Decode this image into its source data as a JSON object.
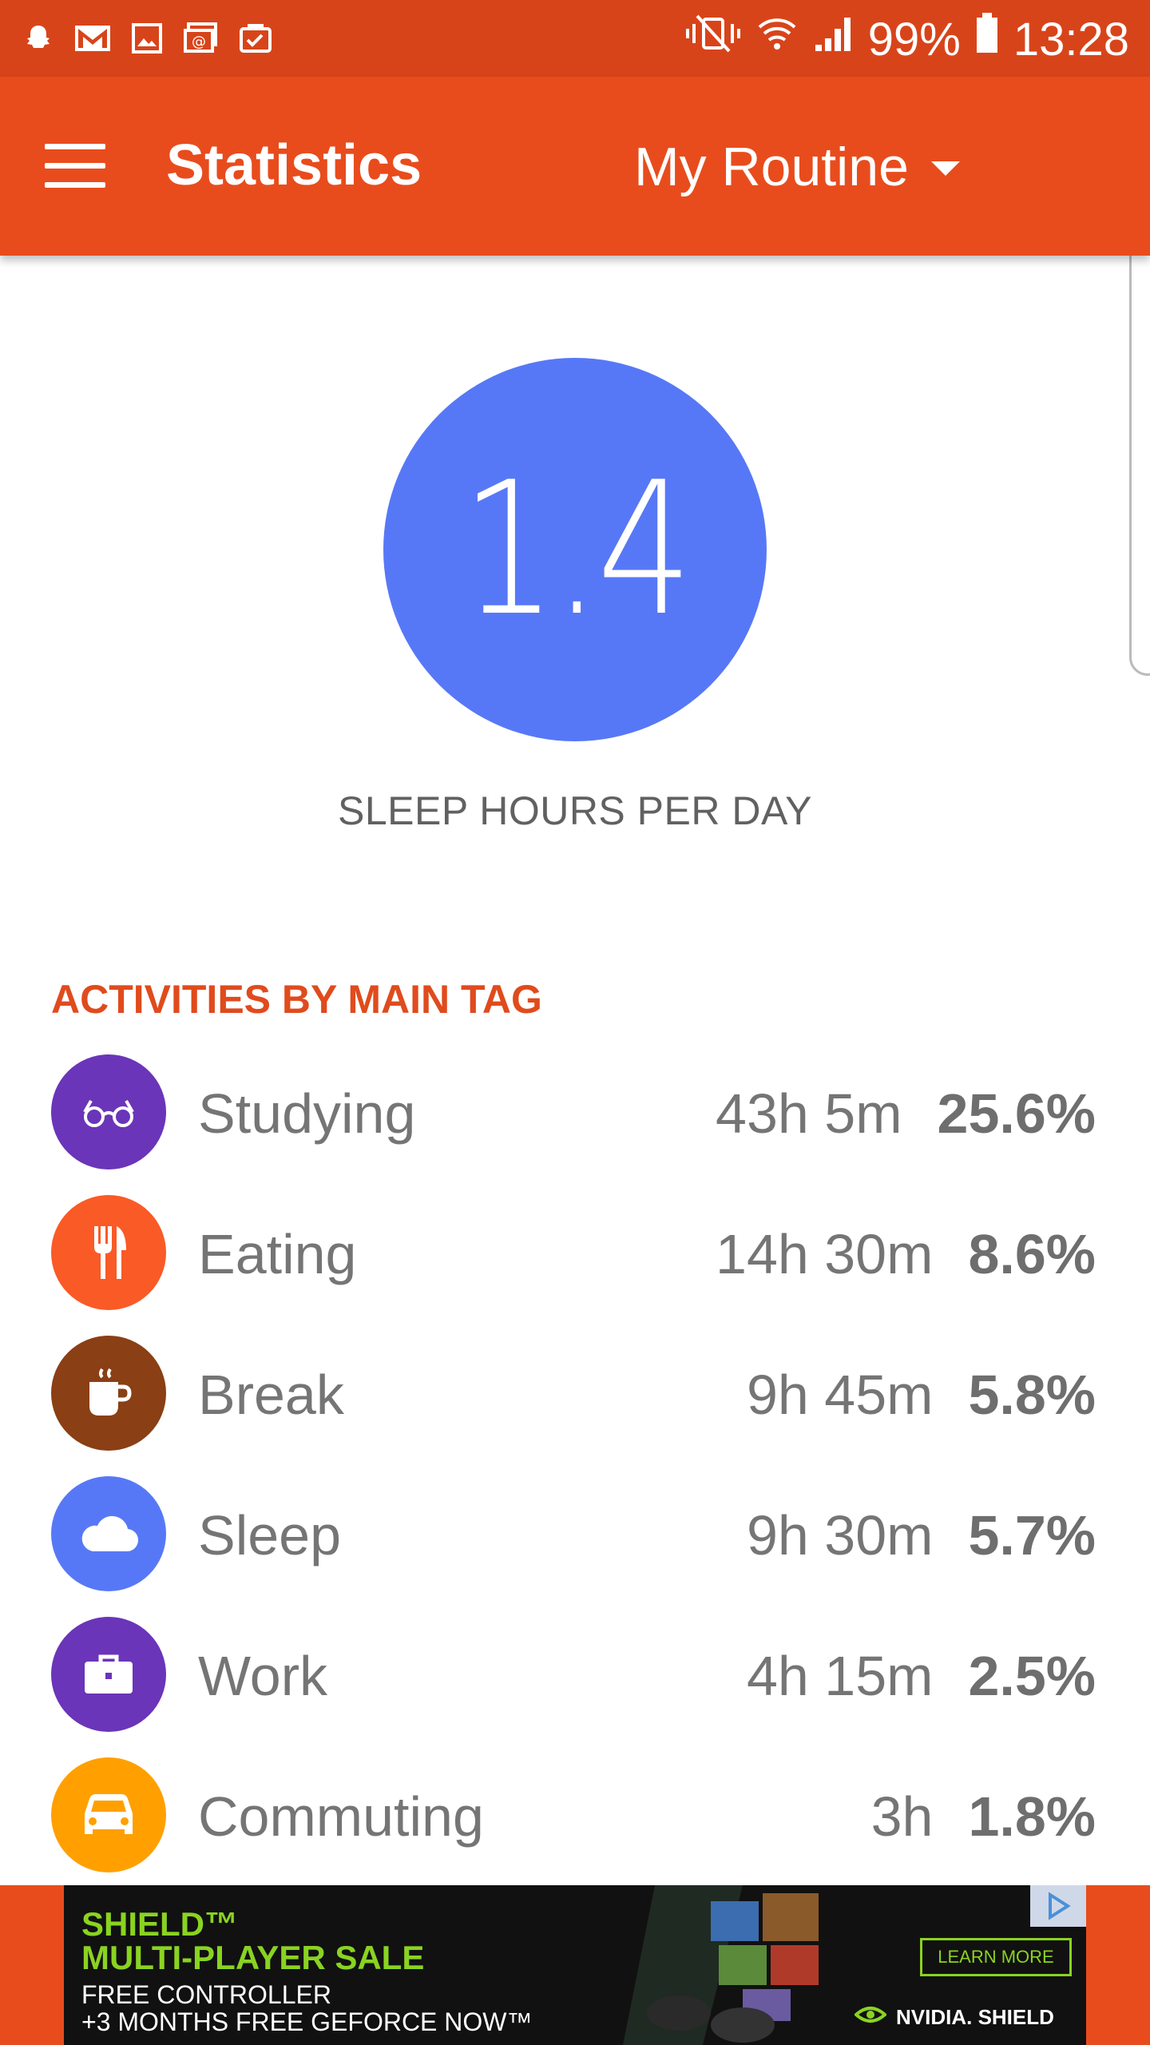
{
  "status_bar": {
    "icons_left": [
      "snapchat-icon",
      "gmail-icon",
      "gallery-icon",
      "email-icon",
      "task-icon"
    ],
    "icons_right": [
      "vibrate-mute-icon",
      "wifi-icon",
      "signal-icon",
      "battery-icon"
    ],
    "battery": "99%",
    "time": "13:28"
  },
  "app_bar": {
    "title": "Statistics",
    "routine_selector": "My Routine"
  },
  "summary": {
    "value": "1.4",
    "caption": "SLEEP HOURS PER DAY",
    "color": "#5778f6"
  },
  "activities": {
    "header": "ACTIVITIES BY MAIN TAG",
    "items": [
      {
        "name": "Studying",
        "duration": "43h 5m",
        "percent": "25.6%",
        "color": "#6a35b8",
        "icon": "glasses-icon"
      },
      {
        "name": "Eating",
        "duration": "14h 30m",
        "percent": "8.6%",
        "color": "#fa5a26",
        "icon": "fork-knife-icon"
      },
      {
        "name": "Break",
        "duration": "9h 45m",
        "percent": "5.8%",
        "color": "#8a3f14",
        "icon": "coffee-cup-icon"
      },
      {
        "name": "Sleep",
        "duration": "9h 30m",
        "percent": "5.7%",
        "color": "#5778f6",
        "icon": "cloud-icon"
      },
      {
        "name": "Work",
        "duration": "4h 15m",
        "percent": "2.5%",
        "color": "#6a35b8",
        "icon": "briefcase-icon"
      },
      {
        "name": "Commuting",
        "duration": "3h",
        "percent": "1.8%",
        "color": "#ffa000",
        "icon": "car-icon"
      }
    ]
  },
  "ad": {
    "headline_1": "SHIELD™",
    "headline_2": "MULTI-PLAYER SALE",
    "line_1": "FREE CONTROLLER",
    "line_2": "+3 MONTHS FREE GEFORCE NOW™",
    "cta": "LEARN MORE",
    "brand": "NVIDIA. SHIELD"
  },
  "colors": {
    "status_bar": "#d8441a",
    "app_bar": "#e84c1d",
    "section_header": "#e04b1d",
    "ad_accent": "#8ad321"
  }
}
